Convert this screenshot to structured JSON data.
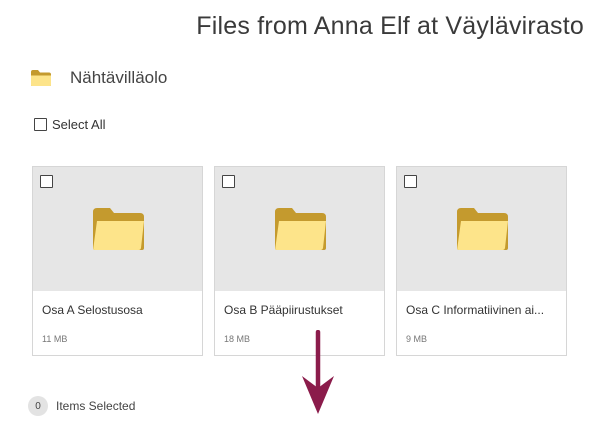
{
  "header": {
    "title": "Files from Anna Elf at Väylävirasto"
  },
  "breadcrumb": {
    "icon": "folder-icon",
    "label": "Nähtävilläolo"
  },
  "selection": {
    "select_all_label": "Select All",
    "count": "0",
    "count_label": "Items Selected"
  },
  "items": [
    {
      "name": "Osa A Selostusosa",
      "size": "11 MB",
      "icon": "folder-icon"
    },
    {
      "name": "Osa B Pääpiirustukset",
      "size": "18 MB",
      "icon": "folder-icon"
    },
    {
      "name": "Osa C Informatiivinen ai...",
      "size": "9 MB",
      "icon": "folder-icon"
    }
  ],
  "colors": {
    "folder_front": "#fde48a",
    "folder_back": "#c49a2e",
    "arrow": "#8b1c4b",
    "thumb_bg": "#e6e6e6"
  }
}
